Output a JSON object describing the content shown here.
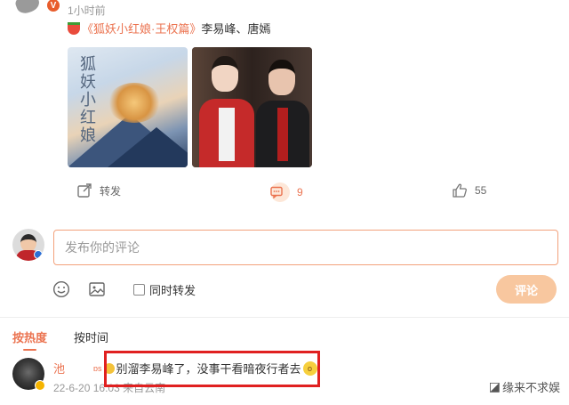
{
  "post": {
    "time_ago": "1小时前",
    "topic": "《狐妖小红娘·王权篇》",
    "text_after_topic": "李易峰、唐嫣",
    "image_1_art_title": "狐妖小红娘"
  },
  "actions": {
    "forward_label": "转发",
    "comment_count": "9",
    "like_count": "55"
  },
  "composer": {
    "placeholder": "发布你的评论",
    "repost_label": "同时转发",
    "submit_label": "评论"
  },
  "sort": {
    "tabs": [
      {
        "label": "按热度",
        "active": true
      },
      {
        "label": "按时间",
        "active": false
      }
    ]
  },
  "comment": {
    "username": "池",
    "user_tag": "ɒs",
    "text": "别溜李易峰了，没事干看暗夜行者去",
    "date": "22-6-20",
    "time_and_source": "16:03 来自云南"
  },
  "watermark": {
    "text": "缘来不求娱"
  },
  "colors": {
    "accent": "#eb7350",
    "highlight_box": "#e02020",
    "input_border": "#f3a27c",
    "submit_button": "#f8c79f"
  },
  "icons": [
    "forward-icon",
    "comment-icon",
    "like-icon",
    "emoji-icon",
    "image-icon",
    "verified-badge-icon"
  ]
}
